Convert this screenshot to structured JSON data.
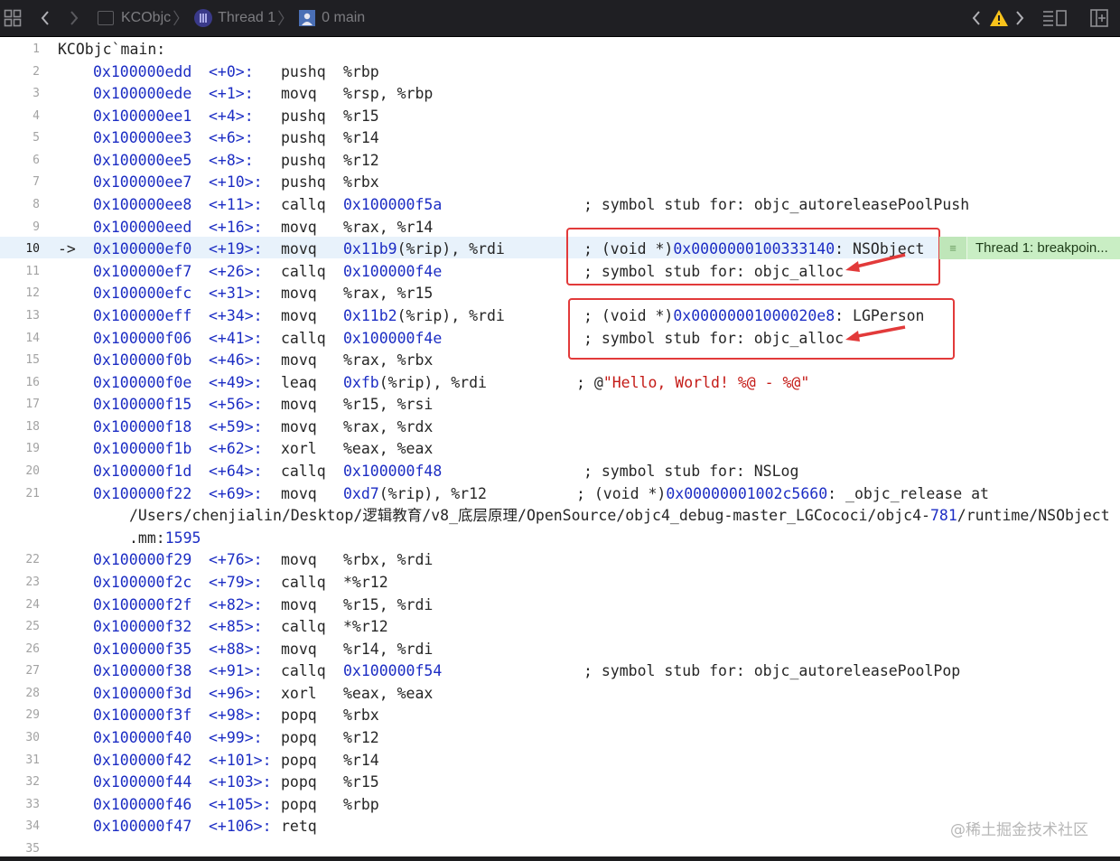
{
  "toolbar": {
    "project": "KCObjc",
    "thread": "Thread 1",
    "frame": "0 main"
  },
  "editor": {
    "function_header": "KCObjc`main:",
    "current_marker": "->",
    "current_line_number": 10,
    "thread_badge": "Thread 1: breakpoin..."
  },
  "lines": [
    {
      "n": "1",
      "header": "KCObjc`main:"
    },
    {
      "n": "2",
      "addr": "0x100000edd",
      "off": "<+0>:",
      "op": "pushq",
      "args": [
        {
          "t": "%rbp",
          "c": "plain"
        }
      ]
    },
    {
      "n": "3",
      "addr": "0x100000ede",
      "off": "<+1>:",
      "op": "movq",
      "args": [
        {
          "t": "%rsp, %rbp",
          "c": "plain"
        }
      ]
    },
    {
      "n": "4",
      "addr": "0x100000ee1",
      "off": "<+4>:",
      "op": "pushq",
      "args": [
        {
          "t": "%r15",
          "c": "plain"
        }
      ]
    },
    {
      "n": "5",
      "addr": "0x100000ee3",
      "off": "<+6>:",
      "op": "pushq",
      "args": [
        {
          "t": "%r14",
          "c": "plain"
        }
      ]
    },
    {
      "n": "6",
      "addr": "0x100000ee5",
      "off": "<+8>:",
      "op": "pushq",
      "args": [
        {
          "t": "%r12",
          "c": "plain"
        }
      ]
    },
    {
      "n": "7",
      "addr": "0x100000ee7",
      "off": "<+10>:",
      "op": "pushq",
      "args": [
        {
          "t": "%rbx",
          "c": "plain"
        }
      ]
    },
    {
      "n": "8",
      "addr": "0x100000ee8",
      "off": "<+11>:",
      "op": "callq",
      "args": [
        {
          "t": "0x100000f5a",
          "c": "num"
        }
      ],
      "comment": [
        {
          "t": "; symbol stub for: objc_autoreleasePoolPush",
          "c": "plain"
        }
      ]
    },
    {
      "n": "9",
      "addr": "0x100000eed",
      "off": "<+16>:",
      "op": "movq",
      "args": [
        {
          "t": "%rax, %r14",
          "c": "plain"
        }
      ]
    },
    {
      "n": "10",
      "addr": "0x100000ef0",
      "off": "<+19>:",
      "op": "movq",
      "args": [
        {
          "t": "0x11b9",
          "c": "num"
        },
        {
          "t": "(%rip), %rdi",
          "c": "plain"
        }
      ],
      "comment": [
        {
          "t": "; (void *)",
          "c": "plain"
        },
        {
          "t": "0x0000000100333140",
          "c": "num"
        },
        {
          "t": ": NSObject",
          "c": "plain"
        }
      ],
      "current": true
    },
    {
      "n": "11",
      "addr": "0x100000ef7",
      "off": "<+26>:",
      "op": "callq",
      "args": [
        {
          "t": "0x100000f4e",
          "c": "num"
        }
      ],
      "comment": [
        {
          "t": "; symbol stub for: objc_alloc",
          "c": "plain"
        }
      ]
    },
    {
      "n": "12",
      "addr": "0x100000efc",
      "off": "<+31>:",
      "op": "movq",
      "args": [
        {
          "t": "%rax, %r15",
          "c": "plain"
        }
      ]
    },
    {
      "n": "13",
      "addr": "0x100000eff",
      "off": "<+34>:",
      "op": "movq",
      "args": [
        {
          "t": "0x11b2",
          "c": "num"
        },
        {
          "t": "(%rip), %rdi",
          "c": "plain"
        }
      ],
      "comment": [
        {
          "t": "; (void *)",
          "c": "plain"
        },
        {
          "t": "0x00000001000020e8",
          "c": "num"
        },
        {
          "t": ": LGPerson",
          "c": "plain"
        }
      ]
    },
    {
      "n": "14",
      "addr": "0x100000f06",
      "off": "<+41>:",
      "op": "callq",
      "args": [
        {
          "t": "0x100000f4e",
          "c": "num"
        }
      ],
      "comment": [
        {
          "t": "; symbol stub for: objc_alloc",
          "c": "plain"
        }
      ]
    },
    {
      "n": "15",
      "addr": "0x100000f0b",
      "off": "<+46>:",
      "op": "movq",
      "args": [
        {
          "t": "%rax, %rbx",
          "c": "plain"
        }
      ]
    },
    {
      "n": "16",
      "addr": "0x100000f0e",
      "off": "<+49>:",
      "op": "leaq",
      "args": [
        {
          "t": "0xfb",
          "c": "num"
        },
        {
          "t": "(%rip), %rdi",
          "c": "plain"
        }
      ],
      "comment": [
        {
          "t": "; @",
          "c": "plain"
        },
        {
          "t": "\"Hello, World! %@ - %@\"",
          "c": "str"
        }
      ],
      "cshift": -8
    },
    {
      "n": "17",
      "addr": "0x100000f15",
      "off": "<+56>:",
      "op": "movq",
      "args": [
        {
          "t": "%r15, %rsi",
          "c": "plain"
        }
      ]
    },
    {
      "n": "18",
      "addr": "0x100000f18",
      "off": "<+59>:",
      "op": "movq",
      "args": [
        {
          "t": "%rax, %rdx",
          "c": "plain"
        }
      ]
    },
    {
      "n": "19",
      "addr": "0x100000f1b",
      "off": "<+62>:",
      "op": "xorl",
      "args": [
        {
          "t": "%eax, %eax",
          "c": "plain"
        }
      ]
    },
    {
      "n": "20",
      "addr": "0x100000f1d",
      "off": "<+64>:",
      "op": "callq",
      "args": [
        {
          "t": "0x100000f48",
          "c": "num"
        }
      ],
      "comment": [
        {
          "t": "; symbol stub for: NSLog",
          "c": "plain"
        }
      ]
    },
    {
      "n": "21",
      "addr": "0x100000f22",
      "off": "<+69>:",
      "op": "movq",
      "args": [
        {
          "t": "0xd7",
          "c": "num"
        },
        {
          "t": "(%rip), %r12",
          "c": "plain"
        }
      ],
      "comment": [
        {
          "t": "; (void *)",
          "c": "plain"
        },
        {
          "t": "0x00000001002c5660",
          "c": "num"
        },
        {
          "t": ": _objc_release at",
          "c": "plain"
        }
      ],
      "cshift": -8,
      "cont": [
        [
          {
            "t": "/Users/chenjialin/Desktop/逻辑教育/v8_底层原理/OpenSource/objc4_debug-master_LGCococi/objc4-",
            "c": "plain"
          },
          {
            "t": "781",
            "c": "num"
          },
          {
            "t": "/runtime/NSObject",
            "c": "plain"
          }
        ],
        [
          {
            "t": ".mm:",
            "c": "plain"
          },
          {
            "t": "1595",
            "c": "num"
          }
        ]
      ]
    },
    {
      "n": "22",
      "addr": "0x100000f29",
      "off": "<+76>:",
      "op": "movq",
      "args": [
        {
          "t": "%rbx, %rdi",
          "c": "plain"
        }
      ]
    },
    {
      "n": "23",
      "addr": "0x100000f2c",
      "off": "<+79>:",
      "op": "callq",
      "args": [
        {
          "t": "*%r12",
          "c": "plain"
        }
      ]
    },
    {
      "n": "24",
      "addr": "0x100000f2f",
      "off": "<+82>:",
      "op": "movq",
      "args": [
        {
          "t": "%r15, %rdi",
          "c": "plain"
        }
      ]
    },
    {
      "n": "25",
      "addr": "0x100000f32",
      "off": "<+85>:",
      "op": "callq",
      "args": [
        {
          "t": "*%r12",
          "c": "plain"
        }
      ]
    },
    {
      "n": "26",
      "addr": "0x100000f35",
      "off": "<+88>:",
      "op": "movq",
      "args": [
        {
          "t": "%r14, %rdi",
          "c": "plain"
        }
      ]
    },
    {
      "n": "27",
      "addr": "0x100000f38",
      "off": "<+91>:",
      "op": "callq",
      "args": [
        {
          "t": "0x100000f54",
          "c": "num"
        }
      ],
      "comment": [
        {
          "t": "; symbol stub for: objc_autoreleasePoolPop",
          "c": "plain"
        }
      ]
    },
    {
      "n": "28",
      "addr": "0x100000f3d",
      "off": "<+96>:",
      "op": "xorl",
      "args": [
        {
          "t": "%eax, %eax",
          "c": "plain"
        }
      ]
    },
    {
      "n": "29",
      "addr": "0x100000f3f",
      "off": "<+98>:",
      "op": "popq",
      "args": [
        {
          "t": "%rbx",
          "c": "plain"
        }
      ]
    },
    {
      "n": "30",
      "addr": "0x100000f40",
      "off": "<+99>:",
      "op": "popq",
      "args": [
        {
          "t": "%r12",
          "c": "plain"
        }
      ]
    },
    {
      "n": "31",
      "addr": "0x100000f42",
      "off": "<+101>:",
      "op": "popq",
      "args": [
        {
          "t": "%r14",
          "c": "plain"
        }
      ]
    },
    {
      "n": "32",
      "addr": "0x100000f44",
      "off": "<+103>:",
      "op": "popq",
      "args": [
        {
          "t": "%r15",
          "c": "plain"
        }
      ]
    },
    {
      "n": "33",
      "addr": "0x100000f46",
      "off": "<+105>:",
      "op": "popq",
      "args": [
        {
          "t": "%rbp",
          "c": "plain"
        }
      ]
    },
    {
      "n": "34",
      "addr": "0x100000f47",
      "off": "<+106>:",
      "op": "retq",
      "args": []
    },
    {
      "n": "35"
    }
  ],
  "watermark": "@稀土掘金技术社区",
  "colors": {
    "address": "#1c2dc4",
    "string": "#c41a16",
    "highlight_box": "#e23a3a",
    "current_line_bg": "#e8f2fb",
    "badge_bg": "#c9eec4",
    "toolbar_bg": "#1f1f23"
  }
}
